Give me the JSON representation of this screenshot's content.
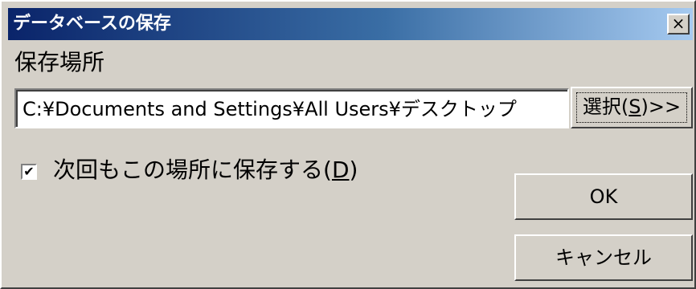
{
  "window": {
    "title": "データベースの保存",
    "close_label": "×"
  },
  "location": {
    "label": "保存場所",
    "path_value": "C:¥Documents and Settings¥All Users¥デスクトップ"
  },
  "select_button": {
    "label_prefix": "選択(",
    "accel": "S",
    "label_suffix": ")>>"
  },
  "checkbox": {
    "checked": true,
    "check_glyph": "✔",
    "label_prefix": "次回もこの場所に保存する(",
    "accel": "D",
    "label_suffix": ")"
  },
  "buttons": {
    "ok_label": "OK",
    "cancel_label": "キャンセル"
  },
  "colors": {
    "title_gradient_start": "#0a246a",
    "title_gradient_end": "#a6caf0",
    "face": "#d4d0c8"
  }
}
